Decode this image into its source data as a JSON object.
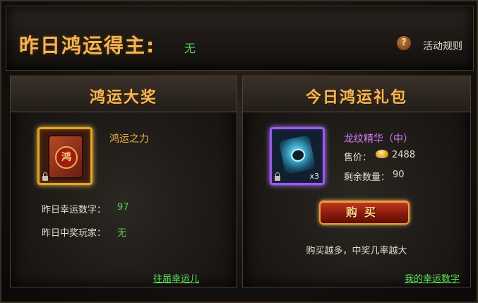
{
  "header": {
    "winner_label": "昨日鸿运得主",
    "winner_colon": ":",
    "winner_value": "无",
    "help_glyph": "?",
    "rules_link": "活动规则"
  },
  "left_panel": {
    "title": "鸿运大奖",
    "item_name": "鸿运之力",
    "item_glyph": "鸿",
    "lucky_number_label": "昨日幸运数字：",
    "lucky_number_value": "97",
    "winner_player_label": "昨日中奖玩家：",
    "winner_player_value": "无",
    "history_link": "往届幸运儿"
  },
  "right_panel": {
    "title": "今日鸿运礼包",
    "item_name": "龙纹精华（中）",
    "item_qty": "x3",
    "price_label": "售价：",
    "price_value": "2488",
    "remaining_label": "剩余数量：",
    "remaining_value": "90",
    "buy_button": "购买",
    "hint": "购买越多，中奖几率越大",
    "my_numbers_link": "我的幸运数字"
  }
}
